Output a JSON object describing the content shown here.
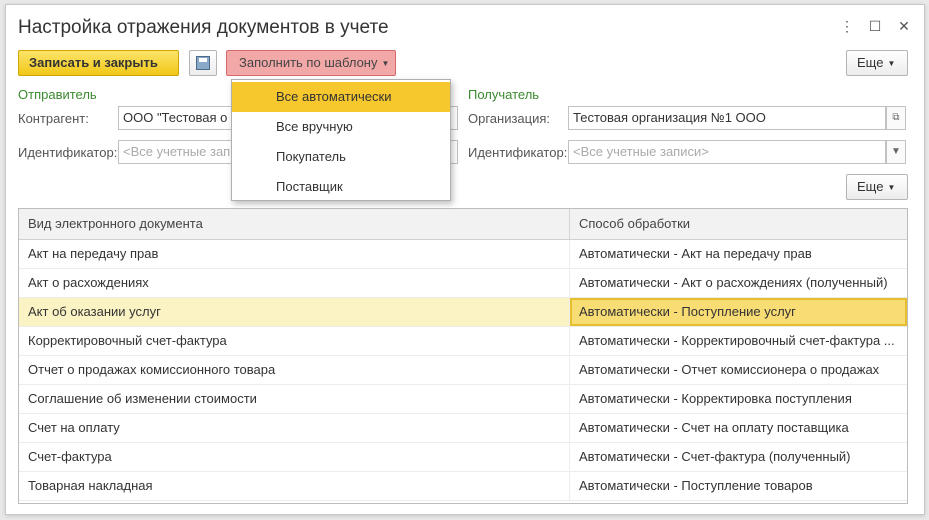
{
  "window": {
    "title": "Настройка отражения документов в учете",
    "more_icon": "⋮",
    "maximize_icon": "☐",
    "close_icon": "✕"
  },
  "toolbar": {
    "save_close_label": "Записать и закрыть",
    "fill_template_label": "Заполнить по шаблону",
    "more_label": "Еще"
  },
  "fill_menu": {
    "items": [
      "Все автоматически",
      "Все вручную",
      "Покупатель",
      "Поставщик"
    ],
    "active_index": 0
  },
  "sender": {
    "section_label": "Отправитель",
    "counterparty_label": "Контрагент:",
    "counterparty_value": "ООО \"Тестовая о",
    "identifier_label": "Идентификатор:",
    "identifier_placeholder": "<Все учетные запи"
  },
  "recipient": {
    "section_label": "Получатель",
    "organization_label": "Организация:",
    "organization_value": "Тестовая организация №1 ООО",
    "identifier_label": "Идентификатор:",
    "identifier_placeholder": "<Все учетные записи>"
  },
  "table_toolbar": {
    "more_label": "Еще"
  },
  "table": {
    "columns": [
      "Вид электронного документа",
      "Способ обработки"
    ],
    "rows": [
      [
        "Акт на передачу прав",
        "Автоматически -  Акт на передачу прав"
      ],
      [
        "Акт о расхождениях",
        "Автоматически -  Акт о расхождениях (полученный)"
      ],
      [
        "Акт об оказании услуг",
        "Автоматически -  Поступление услуг"
      ],
      [
        "Корректировочный счет-фактура",
        "Автоматически -  Корректировочный счет-фактура ..."
      ],
      [
        "Отчет о продажах комиссионного товара",
        "Автоматически -  Отчет комиссионера о продажах"
      ],
      [
        "Соглашение об изменении стоимости",
        "Автоматически -  Корректировка поступления"
      ],
      [
        "Счет на оплату",
        "Автоматически -  Счет на оплату поставщика"
      ],
      [
        "Счет-фактура",
        "Автоматически -  Счет-фактура (полученный)"
      ],
      [
        "Товарная накладная",
        "Автоматически -  Поступление товаров"
      ]
    ],
    "selected_index": 2
  }
}
